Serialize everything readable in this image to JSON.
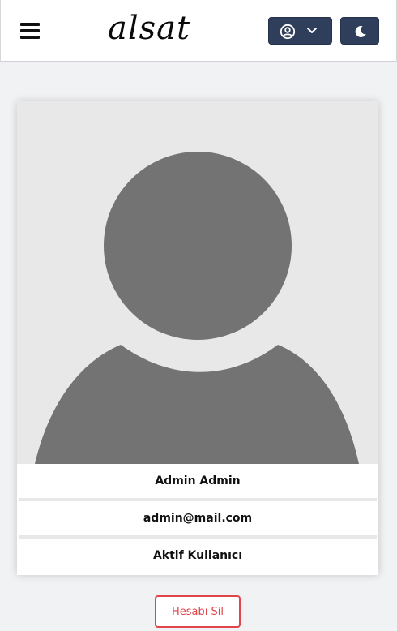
{
  "header": {
    "logo_text": "alsat",
    "menu_icon": "hamburger-menu-icon",
    "user_icon": "user-circle-icon",
    "dropdown_icon": "chevron-down-icon",
    "theme_icon": "moon-icon",
    "button_color": "#2f3e5a"
  },
  "profile": {
    "avatar_icon": "default-user-avatar",
    "name": "Admin Admin",
    "email": "admin@mail.com",
    "status": "Aktif Kullanıcı"
  },
  "actions": {
    "delete_label": "Hesabı Sil",
    "delete_color": "#e0454a"
  }
}
